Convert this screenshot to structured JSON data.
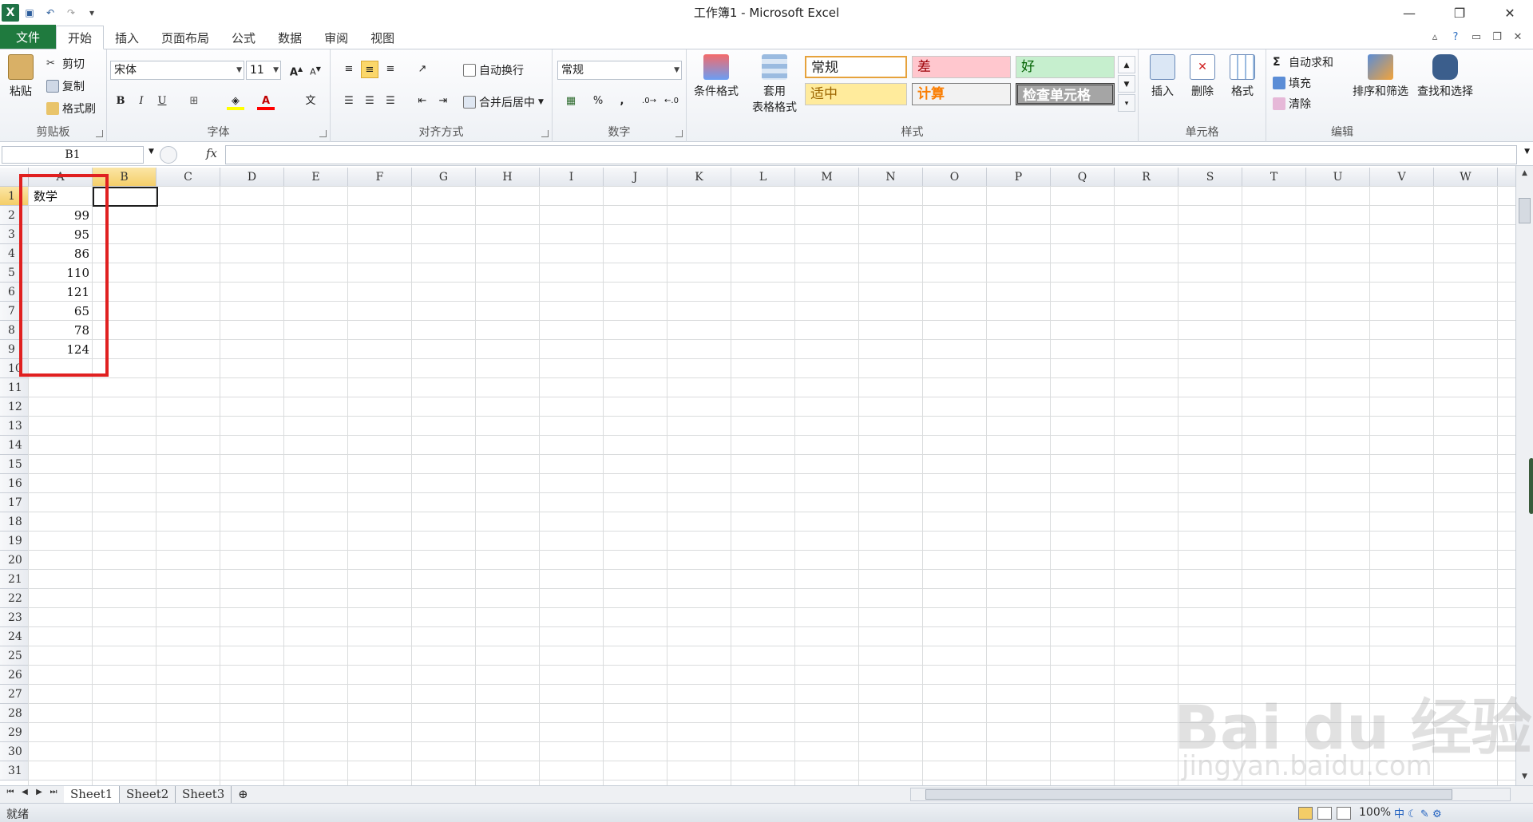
{
  "app": {
    "window_title": "工作簿1 - Microsoft Excel",
    "icon": "excel-icon"
  },
  "ribbon_tabs": [
    {
      "label": "文件"
    },
    {
      "label": "开始"
    },
    {
      "label": "插入"
    },
    {
      "label": "页面布局"
    },
    {
      "label": "公式"
    },
    {
      "label": "数据"
    },
    {
      "label": "审阅"
    },
    {
      "label": "视图"
    }
  ],
  "clipboard": {
    "paste": "粘贴",
    "cut": "剪切",
    "copy": "复制",
    "format_painter": "格式刷",
    "label": "剪贴板"
  },
  "font": {
    "name": "宋体",
    "size": "11",
    "bold": "B",
    "italic": "I",
    "underline": "U",
    "label": "字体"
  },
  "alignment": {
    "wrap": "自动换行",
    "merge": "合并后居中",
    "label": "对齐方式"
  },
  "number": {
    "format": "常规",
    "percent": "%",
    "comma": ",",
    "label": "数字"
  },
  "styles": {
    "conditional": "条件格式",
    "table_format_line1": "套用",
    "table_format_line2": "表格格式",
    "cells": {
      "normal": "常规",
      "bad": "差",
      "good": "好",
      "neutral": "适中",
      "calc": "计算",
      "check": "检查单元格"
    },
    "label": "样式"
  },
  "cells_group": {
    "insert": "插入",
    "delete": "删除",
    "format": "格式",
    "label": "单元格"
  },
  "editing": {
    "autosum": "自动求和",
    "fill": "填充",
    "clear": "清除",
    "sort": "排序和筛选",
    "find": "查找和选择",
    "label": "编辑"
  },
  "formula_bar": {
    "name_box": "B1",
    "fx": "fx",
    "value": ""
  },
  "grid": {
    "columns": [
      "A",
      "B",
      "C",
      "D",
      "E",
      "F",
      "G",
      "H",
      "I",
      "J",
      "K",
      "L",
      "M",
      "N",
      "O",
      "P",
      "Q",
      "R",
      "S",
      "T",
      "U",
      "V",
      "W"
    ],
    "selected_column": "B",
    "selected_row": "1",
    "rows": [
      "1",
      "2",
      "3",
      "4",
      "5",
      "6",
      "7",
      "8",
      "9",
      "10",
      "11",
      "12",
      "13",
      "14",
      "15",
      "16",
      "17",
      "18",
      "19",
      "20",
      "21",
      "22",
      "23",
      "24",
      "25",
      "26",
      "27",
      "28",
      "29",
      "30",
      "31"
    ],
    "column_a": {
      "header": "数学",
      "values": [
        "99",
        "95",
        "86",
        "110",
        "121",
        "65",
        "78",
        "124"
      ]
    }
  },
  "sheets": [
    {
      "label": "Sheet1"
    },
    {
      "label": "Sheet2"
    },
    {
      "label": "Sheet3"
    }
  ],
  "status": {
    "text": "就绪",
    "zoom": "100%"
  },
  "watermark": {
    "logo": "Bai du 经验",
    "url": "jingyan.baidu.com"
  },
  "colors": {
    "file_tab": "#1f7a3e",
    "selection_header": "#f4cd67",
    "highlight_box": "#e02020"
  }
}
